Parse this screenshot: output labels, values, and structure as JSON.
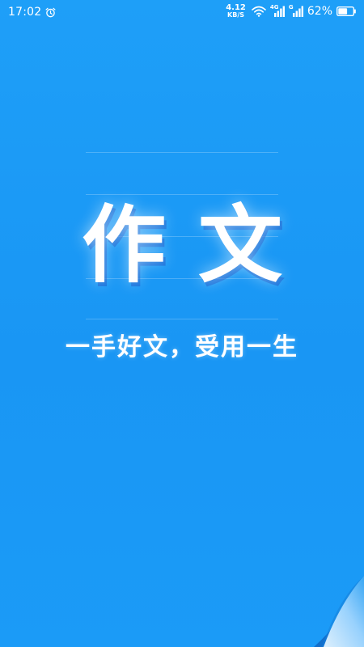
{
  "status_bar": {
    "time": "17:02",
    "alarm_icon": "alarm-clock-icon",
    "net_speed_value": "4.12",
    "net_speed_unit": "KB/S",
    "wifi_icon": "wifi-icon",
    "signal1_tag": "4G",
    "signal2_tag": "G",
    "battery_percent": "62%",
    "battery_level": 0.62
  },
  "hero": {
    "title": "作文",
    "slogan": "一手好文，受用一生"
  },
  "colors": {
    "background": "#1b9bf7",
    "text": "#ffffff"
  }
}
